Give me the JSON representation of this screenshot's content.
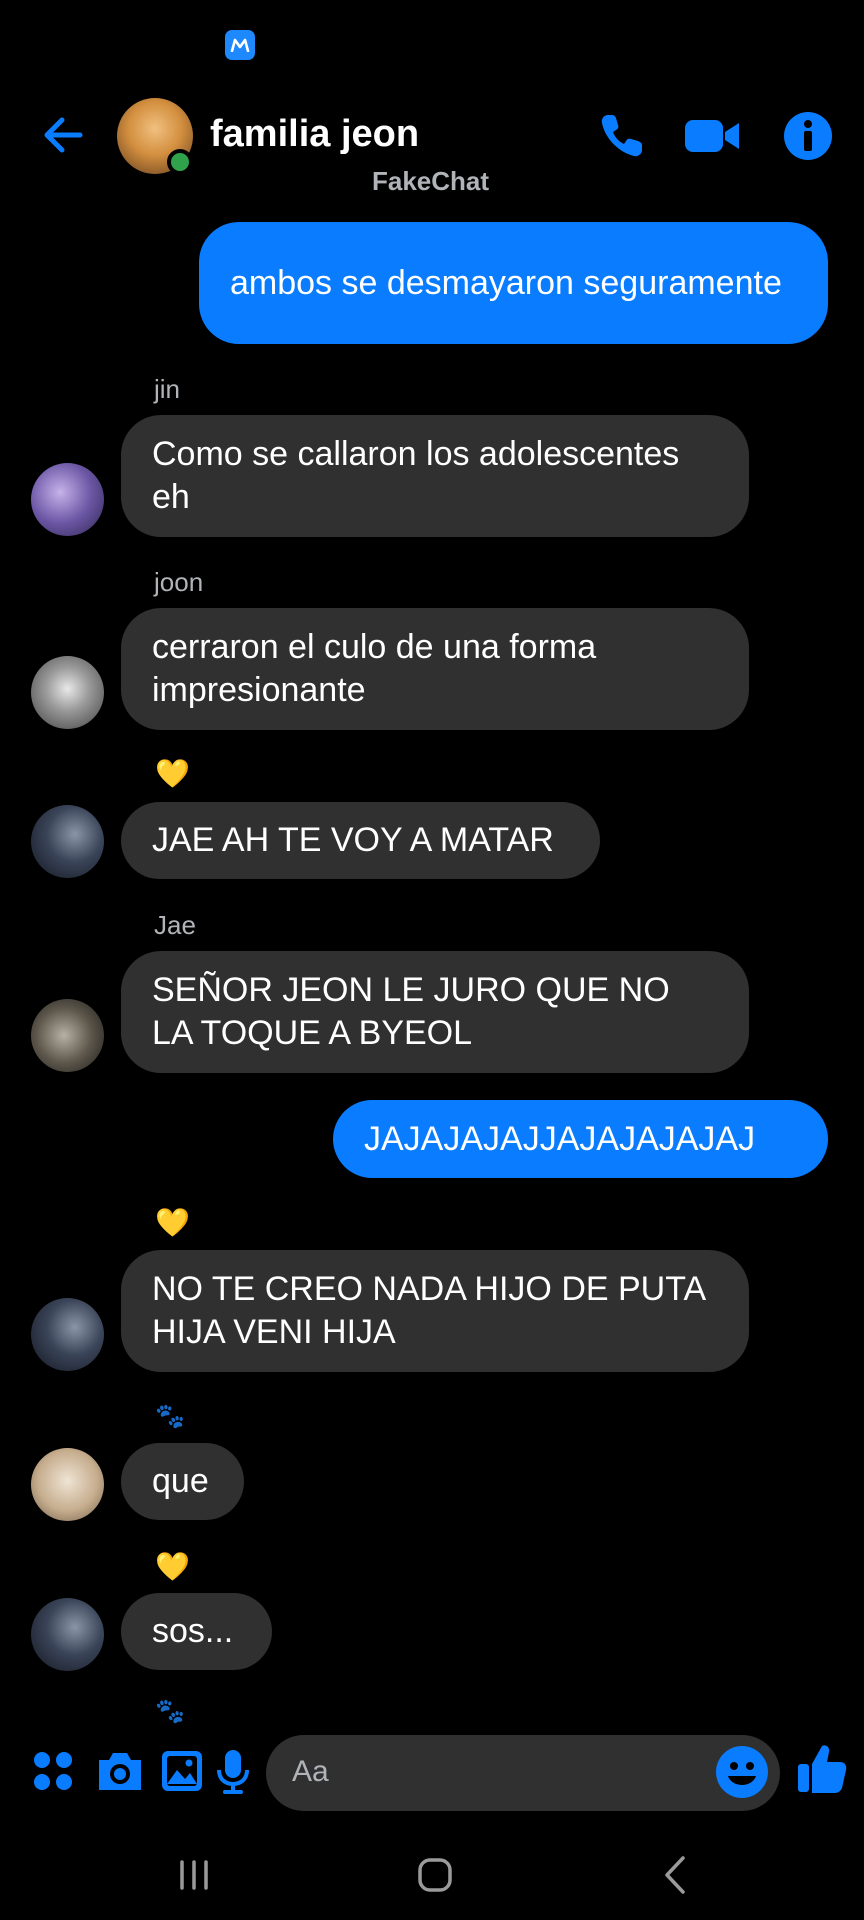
{
  "status_bar": {
    "carrier_logo": "movistar-logo"
  },
  "header": {
    "title": "familia jeon",
    "subtitle": "FakeChat",
    "online": true,
    "icons": [
      "back-arrow-icon",
      "phone-icon",
      "video-camera-icon",
      "info-icon"
    ]
  },
  "messages": [
    {
      "direction": "out",
      "text": "ambos se desmayaron seguramente"
    },
    {
      "direction": "in",
      "sender": "jin",
      "text": "Como se callaron los adolescentes eh"
    },
    {
      "direction": "in",
      "sender": "joon",
      "text": "cerraron el culo de una forma impresionante"
    },
    {
      "direction": "in",
      "reaction": "💛",
      "text": "JAE AH TE VOY A MATAR"
    },
    {
      "direction": "in",
      "sender": "Jae",
      "text": "SEÑOR JEON LE JURO QUE NO LA TOQUE A BYEOL"
    },
    {
      "direction": "out",
      "text": "JAJAJAJAJJAJAJAJAJAJ"
    },
    {
      "direction": "in",
      "reaction": "💛",
      "text": "NO TE CREO NADA HIJO DE PUTA HIJA VENI HIJA"
    },
    {
      "direction": "in",
      "reaction": "🐾",
      "text": "que"
    },
    {
      "direction": "in",
      "reaction": "💛",
      "text": "sos..."
    }
  ],
  "composer": {
    "placeholder": "Aa",
    "icons": [
      "apps-grid-icon",
      "camera-icon",
      "gallery-icon",
      "microphone-icon",
      "emoji-icon",
      "thumbs-up-icon"
    ]
  },
  "colors": {
    "accent": "#0a7cff",
    "incoming_bubble": "#303030",
    "background": "#000000"
  }
}
